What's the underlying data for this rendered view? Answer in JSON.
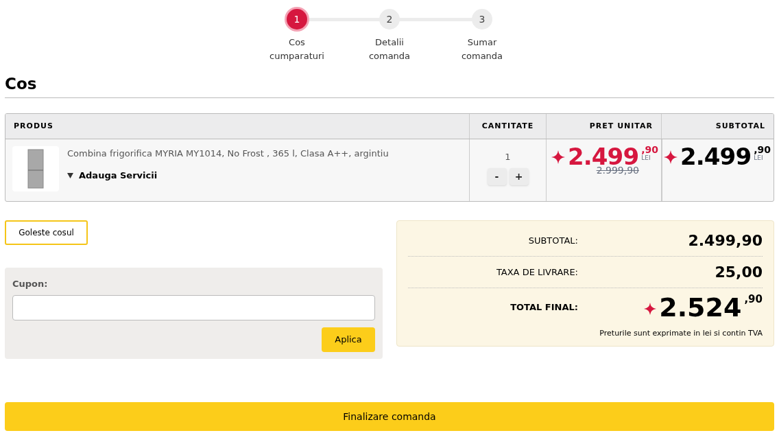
{
  "steps": [
    {
      "number": "1",
      "label": "Cos cumparaturi",
      "selected": true
    },
    {
      "number": "2",
      "label": "Detalii comanda",
      "selected": false
    },
    {
      "number": "3",
      "label": "Sumar comanda",
      "selected": false
    }
  ],
  "heading": "Cos",
  "table": {
    "columns": [
      "PRODUS",
      "CANTITATE",
      "PRET UNITAR",
      "SUBTOTAL"
    ],
    "rows": [
      {
        "name": "Combina frigorifica MYRIA MY1014, No Frost , 365 l, Clasa A++, argintiu",
        "services": "Adauga Servicii",
        "quantity": "1",
        "minus": "-",
        "plus": "+",
        "unit_price": {
          "main": "2.499",
          "decimals": ",90",
          "currency": "LEI",
          "old": "2.999,90"
        },
        "subtotal": {
          "main": "2.499",
          "decimals": ",90",
          "currency": "LEI"
        }
      }
    ]
  },
  "empty_cart_button": "Goleste cosul",
  "coupon": {
    "label": "Cupon:",
    "apply_button": "Aplica"
  },
  "summary": {
    "rows": [
      {
        "label": "SUBTOTAL:",
        "value": "2.499,90"
      },
      {
        "label": "TAXA DE LIVRARE:",
        "value": "25,00"
      }
    ],
    "total": {
      "label": "TOTAL FINAL:",
      "main": "2.524",
      "decimals": ",90"
    },
    "note": "Preturile sunt exprimate in lei si contin TVA"
  },
  "finish_button": "Finalizare comanda"
}
